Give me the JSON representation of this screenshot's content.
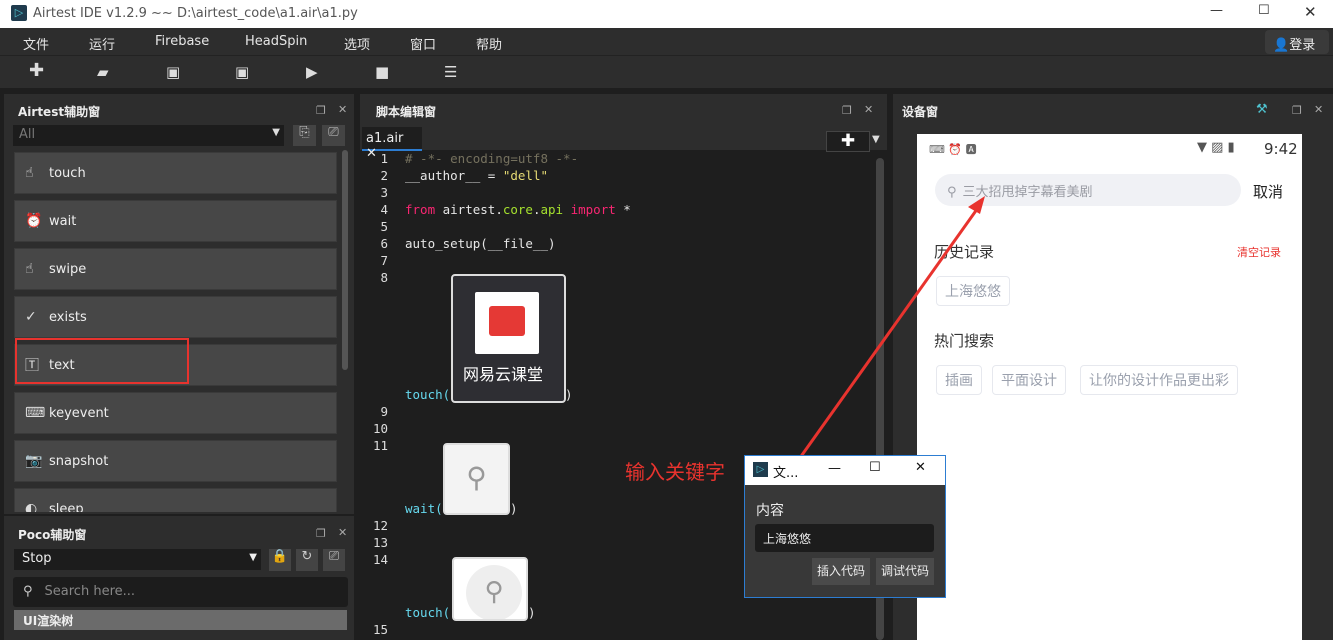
{
  "window": {
    "title": "Airtest IDE v1.2.9 ~~ D:\\airtest_code\\a1.air\\a1.py",
    "login": "登录"
  },
  "menu": [
    "文件",
    "运行",
    "Firebase",
    "HeadSpin",
    "选项",
    "窗口",
    "帮助"
  ],
  "airtest_panel": {
    "title": "Airtest辅助窗",
    "filter": "All",
    "items": [
      "touch",
      "wait",
      "swipe",
      "exists",
      "text",
      "keyevent",
      "snapshot",
      "sleep"
    ]
  },
  "poco_panel": {
    "title": "Poco辅助窗",
    "mode": "Stop",
    "search_placeholder": "Search here...",
    "tree_label": "UI渲染树"
  },
  "editor": {
    "title": "脚本编辑窗",
    "tab": "a1.air",
    "line_numbers": [
      "1",
      "2",
      "3",
      "4",
      "5",
      "6",
      "7",
      "8",
      "9",
      "10",
      "11",
      "12",
      "13",
      "14",
      "15"
    ],
    "lines": {
      "l1": "# -*- encoding=utf8 -*-",
      "l2a": "__author__ = ",
      "l2b": "\"dell\"",
      "l4a": "from",
      "l4b": " airtest.",
      "l4c": "core",
      "l4d": ".",
      "l4e": "api",
      "l4f": "import",
      "l4g": " *",
      "l6": "auto_setup(__file__)",
      "touch": "touch(",
      "wait": "wait(",
      "close": ")"
    },
    "image_label": "网易云课堂"
  },
  "device": {
    "title": "设备窗",
    "time": "9:42",
    "search_placeholder": "三大招甩掉字幕看美剧",
    "cancel": "取消",
    "history_title": "历史记录",
    "clear_history": "清空记录",
    "history": [
      "上海悠悠"
    ],
    "hot_title": "热门搜索",
    "hot": [
      "插画",
      "平面设计",
      "让你的设计作品更出彩"
    ]
  },
  "annotation": {
    "text": "输入关键字",
    "color": "#e8332e"
  },
  "dialog": {
    "title": "文...",
    "label": "内容",
    "value": "上海悠悠",
    "insert": "插入代码",
    "debug": "调试代码"
  }
}
